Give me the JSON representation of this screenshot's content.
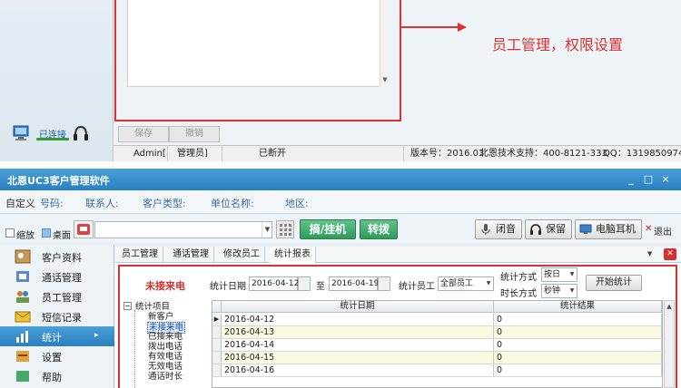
{
  "top": {
    "annotation": "员工管理，权限设置",
    "save_label": "保存",
    "cancel_label": "撤销",
    "connected_label": "已连接",
    "status": {
      "user": "Admin[",
      "role": "管理员]",
      "conn_state": "已断开",
      "version": "版本号：2016.03",
      "support": "北恩技术支持：400-8121-333",
      "qq": "QQ：1319850974"
    }
  },
  "app": {
    "title": "北恩UC3客户管理软件",
    "win_buttons": [
      "_",
      "□",
      "×"
    ],
    "infobar": {
      "custom": "自定义",
      "items": [
        {
          "label": "号码:"
        },
        {
          "label": "联系人:"
        },
        {
          "label": "客户类型:"
        },
        {
          "label": "单位名称:"
        },
        {
          "label": "地区:"
        }
      ]
    },
    "toolbar": {
      "shrink": "缩放",
      "desktop": "桌面",
      "pick_hang": "摘/挂机",
      "transfer": "转拨",
      "mute": "闭音",
      "hold": "保留",
      "pc_headset": "电脑耳机",
      "exit": "退出"
    },
    "sidebar": [
      {
        "label": "客户资料",
        "icon": "customer-icon"
      },
      {
        "label": "通话管理",
        "icon": "call-icon"
      },
      {
        "label": "员工管理",
        "icon": "staff-icon"
      },
      {
        "label": "短信记录",
        "icon": "sms-icon"
      },
      {
        "label": "统计",
        "icon": "stats-icon",
        "active": true
      },
      {
        "label": "设置",
        "icon": "settings-icon"
      },
      {
        "label": "帮助",
        "icon": "help-icon"
      }
    ],
    "tabs": [
      {
        "label": "员工管理"
      },
      {
        "label": "通话管理"
      },
      {
        "label": "修改员工"
      },
      {
        "label": "统计报表",
        "active": true
      }
    ],
    "filter": {
      "title": "未接来电",
      "date_label": "统计日期",
      "start_date": "2016-04-12",
      "to_label": "至",
      "end_date": "2016-04-19",
      "staff_label": "统计员工",
      "staff_value": "全部员工",
      "method_label": "统计方式",
      "method_value": "按日",
      "duration_label": "时长方式",
      "duration_value": "秒钟",
      "start_button": "开始统计"
    },
    "tree": {
      "root": "统计项目",
      "children": [
        "新客户",
        "未接来电",
        "已接来电",
        "拨出电话",
        "有效电话",
        "无效电话",
        "通话时长"
      ]
    },
    "grid": {
      "columns": [
        "统计日期",
        "统计结果"
      ],
      "rows": [
        {
          "date": "2016-04-12",
          "result": "0"
        },
        {
          "date": "2016-04-13",
          "result": "0"
        },
        {
          "date": "2016-04-14",
          "result": "0"
        },
        {
          "date": "2016-04-15",
          "result": "0"
        },
        {
          "date": "2016-04-16",
          "result": "0"
        }
      ]
    }
  }
}
